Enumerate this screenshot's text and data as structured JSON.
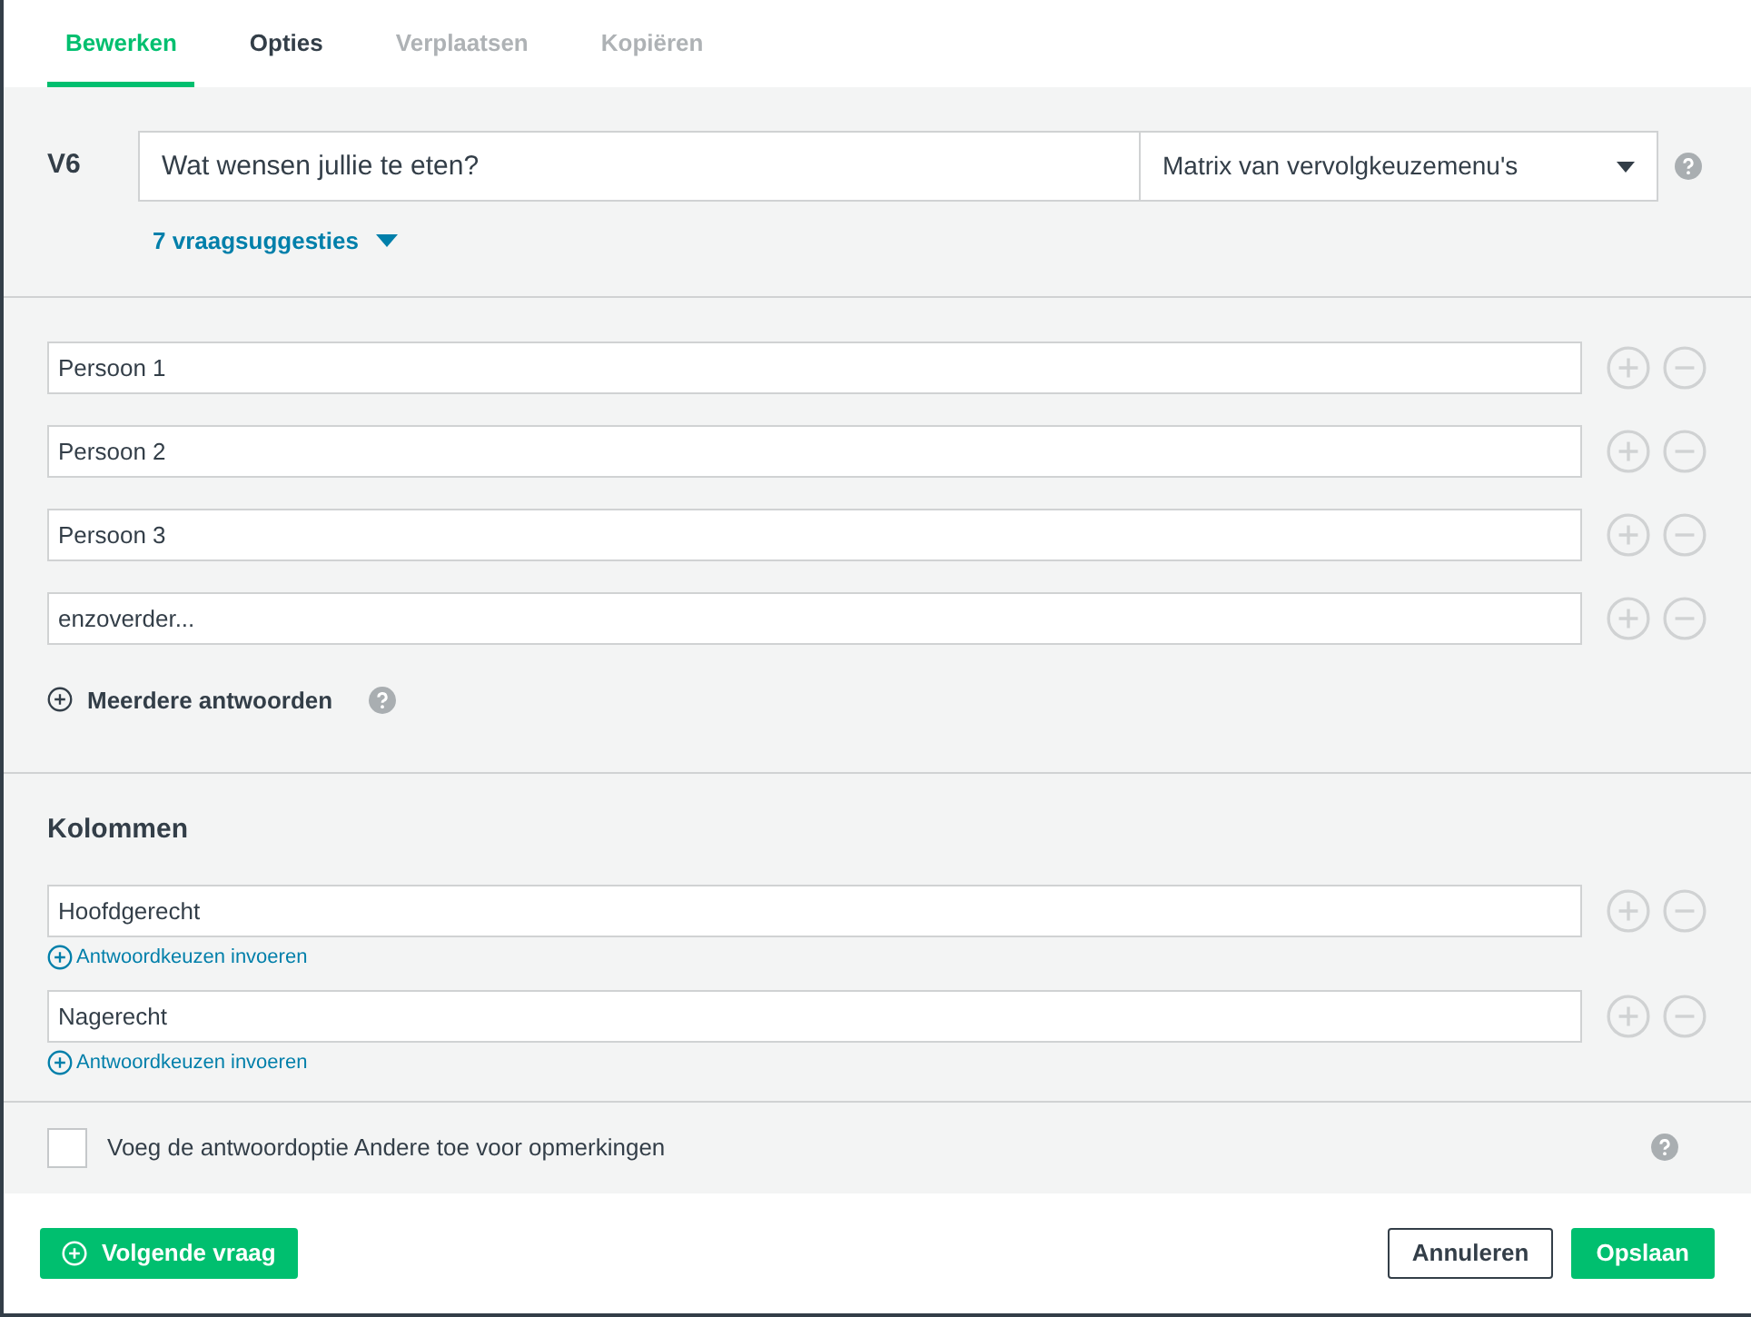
{
  "tabs": [
    {
      "label": "Bewerken",
      "selected": true,
      "disabled": false
    },
    {
      "label": "Opties",
      "selected": false,
      "disabled": false
    },
    {
      "label": "Verplaatsen",
      "selected": false,
      "disabled": true
    },
    {
      "label": "Kopiëren",
      "selected": false,
      "disabled": true
    }
  ],
  "question": {
    "number": "V6",
    "text": "Wat wensen jullie te eten?",
    "type": "Matrix van vervolgkeuzemenu's",
    "suggestions": "7 vraagsuggesties"
  },
  "rows": [
    {
      "value": "Persoon 1"
    },
    {
      "value": "Persoon 2"
    },
    {
      "value": "Persoon 3"
    },
    {
      "value": "enzoverder..."
    }
  ],
  "more_answers": "Meerdere antwoorden",
  "columns_section": {
    "title": "Kolommen",
    "columns": [
      {
        "value": "Hoofdgerecht",
        "link": "Antwoordkeuzen invoeren"
      },
      {
        "value": "Nagerecht",
        "link": "Antwoordkeuzen invoeren"
      }
    ]
  },
  "other_option": {
    "label": "Voeg de antwoordoptie Andere toe voor opmerkingen",
    "checked": false
  },
  "footer": {
    "next": "Volgende vraag",
    "cancel": "Annuleren",
    "save": "Opslaan"
  }
}
